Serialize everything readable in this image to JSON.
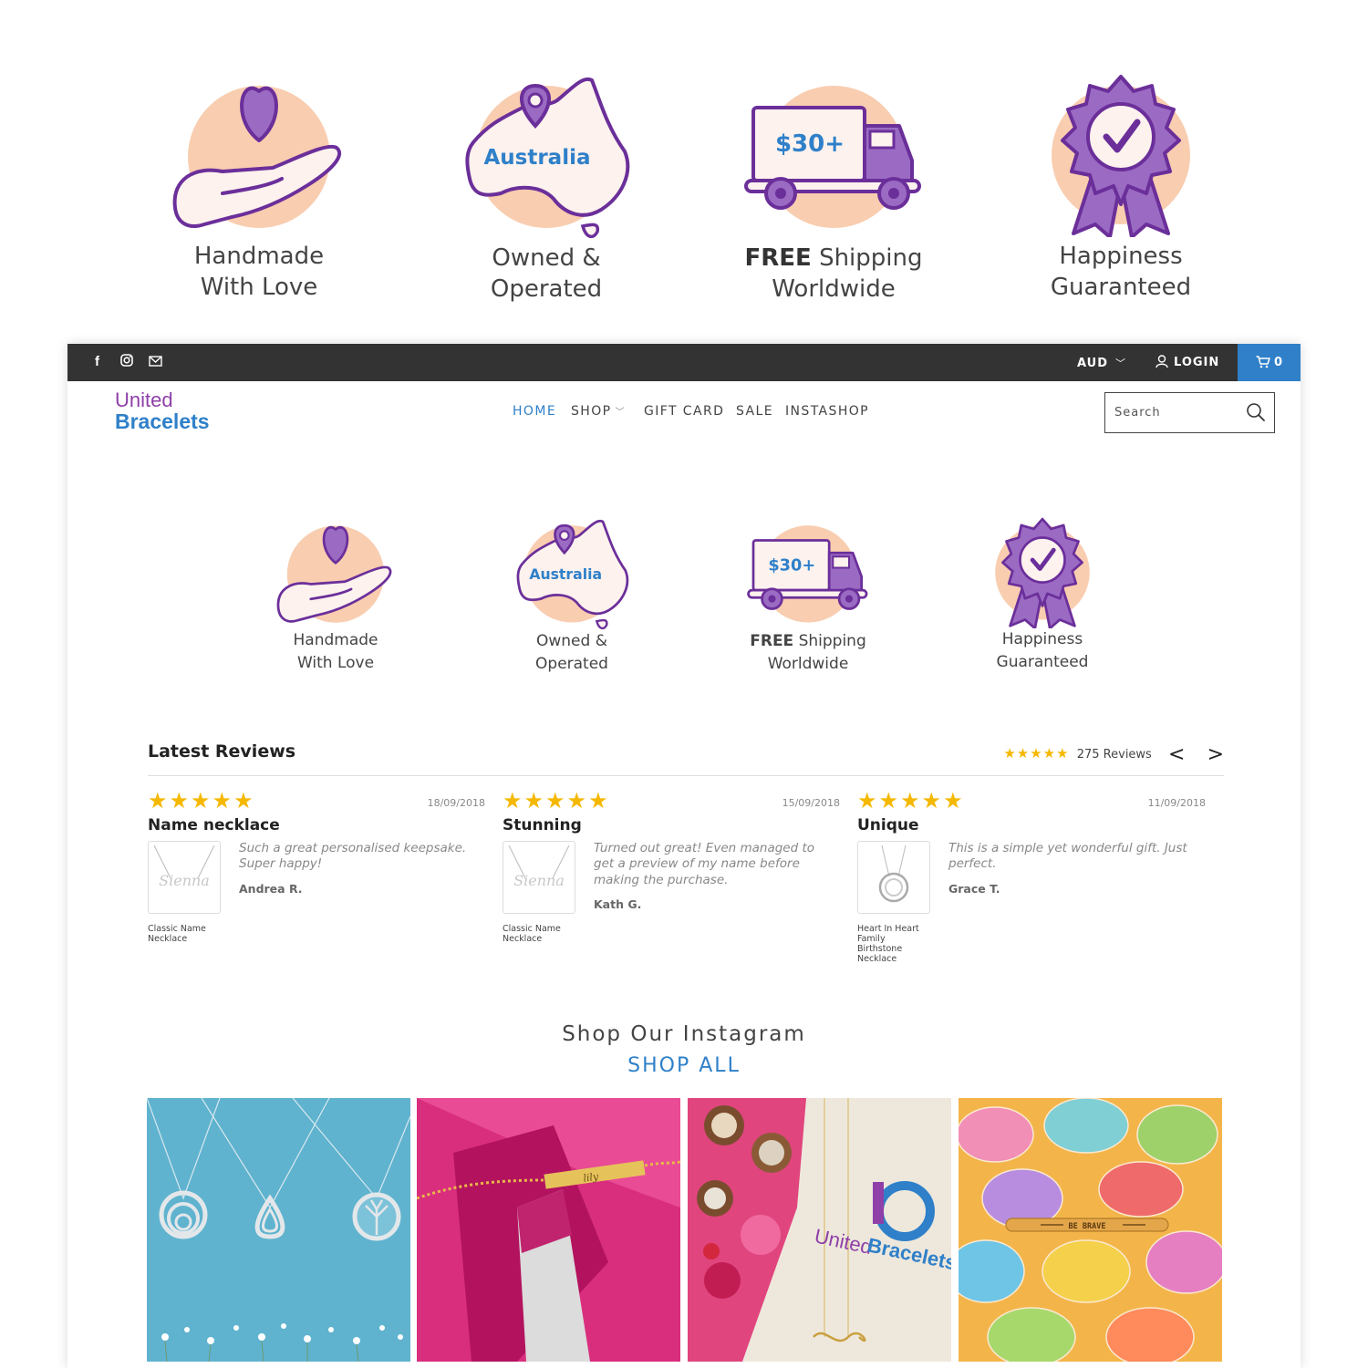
{
  "features_top": [
    {
      "line1": "Handmade",
      "line2": "With Love"
    },
    {
      "map_label": "Australia",
      "line1": "Owned &",
      "line2": "Operated"
    },
    {
      "badge": "$30+",
      "bold": "FREE",
      "line1_rest": " Shipping",
      "line2": "Worldwide"
    },
    {
      "line1": "Happiness",
      "line2": "Guaranteed"
    }
  ],
  "topbar": {
    "social_icons": [
      "facebook-icon",
      "instagram-icon",
      "mail-icon"
    ],
    "currency": "AUD",
    "login": "LOGIN",
    "cart_count": "0"
  },
  "logo": {
    "line1": "United",
    "line2": "Bracelets"
  },
  "nav": {
    "items": [
      "HOME",
      "SHOP",
      "GIFT CARD",
      "SALE",
      "INSTASHOP"
    ],
    "active": "HOME"
  },
  "search": {
    "placeholder": "Search"
  },
  "features_inner": [
    {
      "line1": "Handmade",
      "line2": "With Love"
    },
    {
      "map_label": "Australia",
      "line1": "Owned &",
      "line2": "Operated"
    },
    {
      "badge": "$30+",
      "bold": "FREE",
      "line1_rest": " Shipping",
      "line2": "Worldwide"
    },
    {
      "line1": "Happiness",
      "line2": "Guaranteed"
    }
  ],
  "reviews": {
    "heading": "Latest Reviews",
    "summary_stars": "★★★★★",
    "summary_count": "275 Reviews",
    "prev": "<",
    "next": ">",
    "items": [
      {
        "stars": "★★★★★",
        "date": "18/09/2018",
        "title": "Name necklace",
        "text": "Such a great personalised keepsake. Super happy!",
        "author": "Andrea R.",
        "product": "Classic Name Necklace"
      },
      {
        "stars": "★★★★★",
        "date": "15/09/2018",
        "title": "Stunning",
        "text": "Turned out great! Even managed to get a preview of my name before making the purchase.",
        "author": "Kath G.",
        "product": "Classic Name Necklace"
      },
      {
        "stars": "★★★★★",
        "date": "11/09/2018",
        "title": "Unique",
        "text": "This is a simple yet wonderful gift. Just perfect.",
        "author": "Grace T.",
        "product": "Heart In Heart Family Birthstone Necklace"
      }
    ]
  },
  "instagram": {
    "title": "Shop Our Instagram",
    "link": "SHOP ALL",
    "tiles": [
      {
        "image": "necklaces-on-blue"
      },
      {
        "image": "bar-bracelet-on-pink",
        "engraving": "lily"
      },
      {
        "image": "infinity-necklace-with-chocolates",
        "print_line1": "United",
        "print_line2": "Bracelets"
      },
      {
        "image": "be-brave-cuff-on-colorful-leaves",
        "engraving": "BE BRAVE"
      }
    ]
  },
  "colors": {
    "accent_blue": "#2f80c9",
    "purple": "#8e3fa8",
    "peach": "#f9cdb0",
    "star": "#f5b800",
    "topbar": "#333333"
  }
}
